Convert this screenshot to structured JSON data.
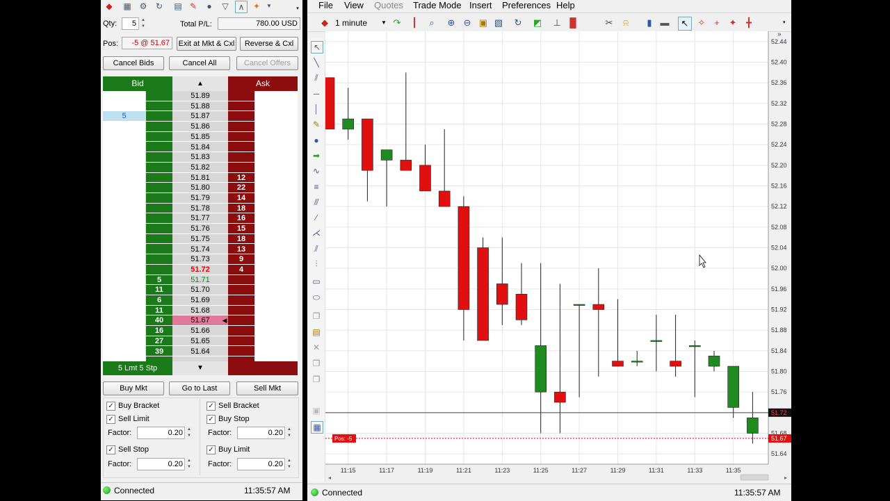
{
  "dom": {
    "qty_label": "Qty:",
    "qty_value": "5",
    "total_pl_label": "Total P/L:",
    "total_pl_value": "780.00 USD",
    "pos_label": "Pos:",
    "pos_value": "-5 @ 51.67",
    "exit_btn": "Exit at Mkt & Cxl",
    "reverse_btn": "Reverse & Cxl",
    "cancel_bids_btn": "Cancel Bids",
    "cancel_all_btn": "Cancel All",
    "cancel_offers_btn": "Cancel Offers",
    "bid_header": "Bid",
    "ask_header": "Ask",
    "ladder": [
      {
        "price": "51.89",
        "bid": "",
        "ask": "",
        "my": ""
      },
      {
        "price": "51.88",
        "bid": "",
        "ask": "",
        "my": ""
      },
      {
        "price": "51.87",
        "bid": "",
        "ask": "",
        "my": "5"
      },
      {
        "price": "51.86",
        "bid": "",
        "ask": "",
        "my": ""
      },
      {
        "price": "51.85",
        "bid": "",
        "ask": "",
        "my": ""
      },
      {
        "price": "51.84",
        "bid": "",
        "ask": "",
        "my": ""
      },
      {
        "price": "51.83",
        "bid": "",
        "ask": "",
        "my": ""
      },
      {
        "price": "51.82",
        "bid": "",
        "ask": "",
        "my": ""
      },
      {
        "price": "51.81",
        "bid": "",
        "ask": "12",
        "my": ""
      },
      {
        "price": "51.80",
        "bid": "",
        "ask": "22",
        "my": ""
      },
      {
        "price": "51.79",
        "bid": "",
        "ask": "14",
        "my": ""
      },
      {
        "price": "51.78",
        "bid": "",
        "ask": "18",
        "my": ""
      },
      {
        "price": "51.77",
        "bid": "",
        "ask": "16",
        "my": ""
      },
      {
        "price": "51.76",
        "bid": "",
        "ask": "15",
        "my": ""
      },
      {
        "price": "51.75",
        "bid": "",
        "ask": "18",
        "my": ""
      },
      {
        "price": "51.74",
        "bid": "",
        "ask": "13",
        "my": ""
      },
      {
        "price": "51.73",
        "bid": "",
        "ask": "9",
        "my": ""
      },
      {
        "price": "51.72",
        "bid": "",
        "ask": "4",
        "my": "",
        "last": true
      },
      {
        "price": "51.71",
        "bid": "5",
        "ask": "",
        "my": "",
        "green": true
      },
      {
        "price": "51.70",
        "bid": "11",
        "ask": "",
        "my": ""
      },
      {
        "price": "51.69",
        "bid": "6",
        "ask": "",
        "my": ""
      },
      {
        "price": "51.68",
        "bid": "11",
        "ask": "",
        "my": ""
      },
      {
        "price": "51.67",
        "bid": "40",
        "ask": "",
        "my": "",
        "pos": true
      },
      {
        "price": "51.66",
        "bid": "16",
        "ask": "",
        "my": ""
      },
      {
        "price": "51.65",
        "bid": "27",
        "ask": "",
        "my": ""
      },
      {
        "price": "51.64",
        "bid": "39",
        "ask": "",
        "my": ""
      }
    ],
    "footer_left": "5 Lmt 5 Stp",
    "buy_mkt_btn": "Buy Mkt",
    "go_to_last_btn": "Go to Last",
    "sell_mkt_btn": "Sell Mkt",
    "buy_bracket": "Buy Bracket",
    "sell_bracket": "Sell Bracket",
    "sell_limit": "Sell Limit",
    "buy_stop": "Buy Stop",
    "sell_stop": "Sell Stop",
    "buy_limit": "Buy Limit",
    "factor_label": "Factor:",
    "factor_value": "0.20",
    "status": "Connected",
    "time": "11:35:57 AM"
  },
  "chart": {
    "menu": [
      "File",
      "View",
      "Quotes",
      "Trade Mode",
      "Insert",
      "Preferences",
      "Help"
    ],
    "interval": "1 minute",
    "status": "Connected",
    "time": "11:35:57 AM",
    "y_ticks": [
      "52.44",
      "52.40",
      "52.36",
      "52.32",
      "52.28",
      "52.24",
      "52.20",
      "52.16",
      "52.12",
      "52.08",
      "52.04",
      "52.00",
      "51.96",
      "51.92",
      "51.88",
      "51.84",
      "51.80",
      "51.76",
      "51.72",
      "51.68",
      "51.64"
    ],
    "x_ticks": [
      "11:15",
      "11:17",
      "11:19",
      "11:21",
      "11:23",
      "11:25",
      "11:27",
      "11:29",
      "11:31",
      "11:33",
      "11:35"
    ],
    "last_price_tag": "51.72",
    "pos_price_tag": "51.67",
    "pos_label": "Pos: -5",
    "up_color": "#1f8a1f",
    "down_color": "#e01010"
  },
  "chart_data": {
    "type": "candlestick",
    "x": [
      "11:14",
      "11:15",
      "11:16",
      "11:17",
      "11:18",
      "11:19",
      "11:20",
      "11:21",
      "11:22",
      "11:23",
      "11:24",
      "11:25",
      "11:26",
      "11:27",
      "11:28",
      "11:29",
      "11:30",
      "11:31",
      "11:32",
      "11:33",
      "11:34",
      "11:35",
      "11:36"
    ],
    "open": [
      52.37,
      52.27,
      52.29,
      52.21,
      52.21,
      52.2,
      52.15,
      52.12,
      52.04,
      51.97,
      51.95,
      51.76,
      51.76,
      51.93,
      51.93,
      51.82,
      51.82,
      51.86,
      51.82,
      51.85,
      51.81,
      51.73,
      51.68
    ],
    "high": [
      52.37,
      52.35,
      52.28,
      52.23,
      52.38,
      52.24,
      52.27,
      52.14,
      52.06,
      52.06,
      52.01,
      52.01,
      51.97,
      51.93,
      52.0,
      51.94,
      51.84,
      51.91,
      51.91,
      51.86,
      51.84,
      51.81,
      51.76
    ],
    "low": [
      52.27,
      52.25,
      52.13,
      52.12,
      52.19,
      52.19,
      52.12,
      51.86,
      51.86,
      51.89,
      51.89,
      51.68,
      51.68,
      51.75,
      51.79,
      51.81,
      51.81,
      51.8,
      51.79,
      51.75,
      51.8,
      51.71,
      51.66
    ],
    "close": [
      52.27,
      52.29,
      52.19,
      52.23,
      52.19,
      52.15,
      52.12,
      51.92,
      51.86,
      51.93,
      51.9,
      51.85,
      51.74,
      51.93,
      51.92,
      51.81,
      51.82,
      51.86,
      51.81,
      51.85,
      51.83,
      51.81,
      51.71
    ],
    "ylim": [
      51.62,
      52.46
    ],
    "horizontal_lines": [
      51.72,
      51.67
    ]
  }
}
